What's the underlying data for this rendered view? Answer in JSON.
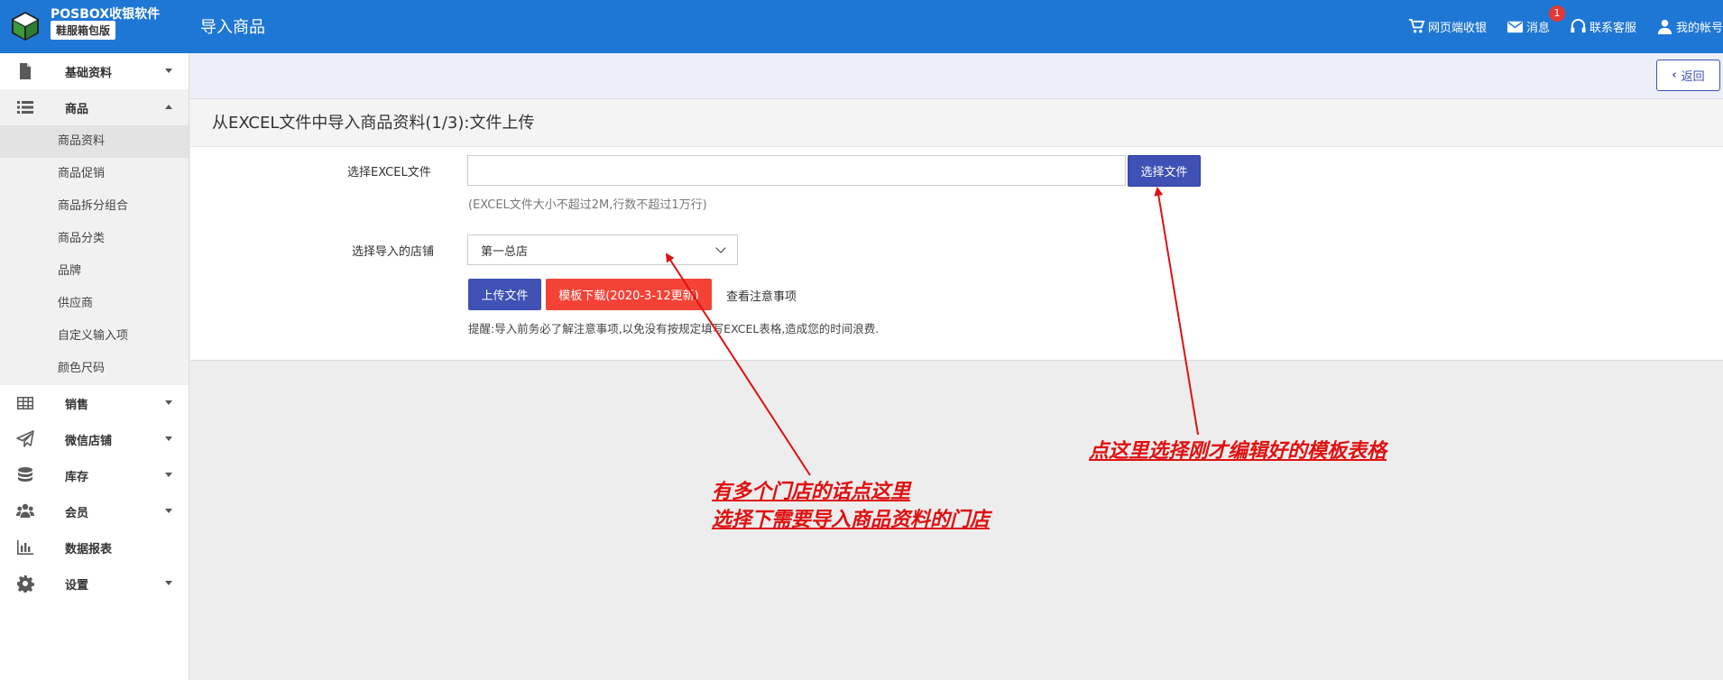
{
  "header": {
    "brand_name": "POSBOX收银软件",
    "brand_edition": "鞋服箱包版",
    "page_title": "导入商品",
    "actions": [
      {
        "icon": "cart-icon",
        "label": "网页端收银"
      },
      {
        "icon": "envelope-icon",
        "label": "消息",
        "badge": "1"
      },
      {
        "icon": "headset-icon",
        "label": "联系客服"
      },
      {
        "icon": "user-icon",
        "label": "我的帐号"
      }
    ]
  },
  "sidebar": {
    "groups": [
      {
        "icon": "file-icon",
        "label": "基础资料",
        "expanded": false
      },
      {
        "icon": "list-icon",
        "label": "商品",
        "expanded": true,
        "items": [
          "商品资料",
          "商品促销",
          "商品拆分组合",
          "商品分类",
          "品牌",
          "供应商",
          "自定义输入项",
          "颜色尺码"
        ],
        "active_item": "商品资料"
      },
      {
        "icon": "table-icon",
        "label": "销售",
        "expanded": false
      },
      {
        "icon": "paper-plane-icon",
        "label": "微信店铺",
        "expanded": false
      },
      {
        "icon": "database-icon",
        "label": "库存",
        "expanded": false
      },
      {
        "icon": "users-icon",
        "label": "会员",
        "expanded": false
      },
      {
        "icon": "bar-chart-icon",
        "label": "数据报表",
        "expanded": false
      },
      {
        "icon": "gear-icon",
        "label": "设置",
        "expanded": false
      }
    ]
  },
  "toolbar": {
    "back_label": "返回"
  },
  "form": {
    "section_title": "从EXCEL文件中导入商品资料(1/3):文件上传",
    "file_label": "选择EXCEL文件",
    "file_value": "",
    "choose_button": "选择文件",
    "file_hint": "(EXCEL文件大小不超过2M,行数不超过1万行)",
    "store_label": "选择导入的店铺",
    "store_selected": "第一总店",
    "upload_button": "上传文件",
    "template_button": "模板下载(2020-3-12更新)",
    "notes_link": "查看注意事项",
    "reminder": "提醒:导入前务必了解注意事项,以免没有按规定填写EXCEL表格,造成您的时间浪费."
  },
  "annotations": {
    "store_note_line1": "有多个门店的话点这里",
    "store_note_line2": "选择下需要导入商品资料的门店",
    "file_note": "点这里选择刚才编辑好的模板表格"
  },
  "colors": {
    "header_bg": "#1f77d5",
    "primary": "#3f51b5",
    "danger": "#f44336",
    "annotation": "#e01010"
  }
}
